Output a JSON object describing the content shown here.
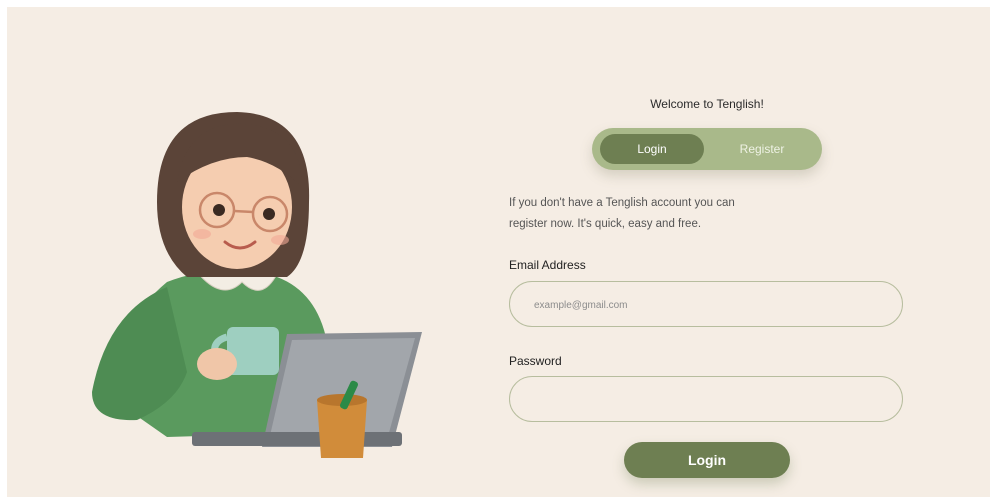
{
  "welcome": "Welcome to Tenglish!",
  "tabs": {
    "login": "Login",
    "register": "Register"
  },
  "description": {
    "line1": "If you don't have a Tenglish account you can",
    "line2": "register now. It's quick, easy and free."
  },
  "email": {
    "label": "Email Address",
    "placeholder": "example@gmail.com",
    "value": ""
  },
  "password": {
    "label": "Password",
    "value": ""
  },
  "submit_label": "Login",
  "colors": {
    "background": "#f5ede4",
    "accent": "#6e7f52",
    "accent_light": "#a9b98a",
    "field_border": "#b7bd9e"
  },
  "illustration": "girl-with-laptop-and-mug"
}
